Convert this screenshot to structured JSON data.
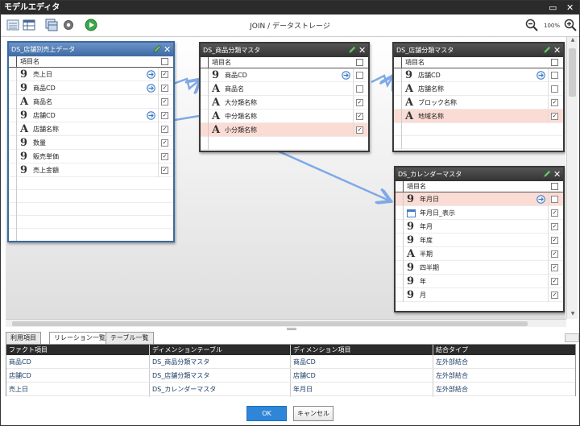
{
  "window": {
    "title": "モデルエディタ"
  },
  "toolbar": {
    "title": "JOIN / データストレージ",
    "zoom": "100%",
    "icons": [
      "list-view-icon",
      "table-view-icon",
      "add-table-icon",
      "settings-gear-icon",
      "run-icon",
      "zoom-out-icon",
      "zoom-in-icon"
    ]
  },
  "tables": [
    {
      "name": "DS_店舗別売上データ",
      "column_header": "項目名",
      "rows": [
        {
          "icon": "9",
          "name": "売上日",
          "join": true,
          "checked": true,
          "hl": false
        },
        {
          "icon": "9",
          "name": "商品CD",
          "join": true,
          "checked": true,
          "hl": false
        },
        {
          "icon": "A",
          "name": "商品名",
          "join": false,
          "checked": true,
          "hl": false
        },
        {
          "icon": "9",
          "name": "店舗CD",
          "join": true,
          "checked": true,
          "hl": false
        },
        {
          "icon": "A",
          "name": "店舗名称",
          "join": false,
          "checked": true,
          "hl": false
        },
        {
          "icon": "9",
          "name": "数量",
          "join": false,
          "checked": true,
          "hl": false
        },
        {
          "icon": "9",
          "name": "販売単価",
          "join": false,
          "checked": true,
          "hl": false
        },
        {
          "icon": "9",
          "name": "売上金額",
          "join": false,
          "checked": true,
          "hl": false
        }
      ]
    },
    {
      "name": "DS_商品分類マスタ",
      "column_header": "項目名",
      "rows": [
        {
          "icon": "9",
          "name": "商品CD",
          "join": true,
          "checked": false,
          "hl": false
        },
        {
          "icon": "A",
          "name": "商品名",
          "join": false,
          "checked": false,
          "hl": false
        },
        {
          "icon": "A",
          "name": "大分類名称",
          "join": false,
          "checked": true,
          "hl": false
        },
        {
          "icon": "A",
          "name": "中分類名称",
          "join": false,
          "checked": true,
          "hl": false
        },
        {
          "icon": "A",
          "name": "小分類名称",
          "join": false,
          "checked": true,
          "hl": true
        }
      ]
    },
    {
      "name": "DS_店舗分類マスタ",
      "column_header": "項目名",
      "rows": [
        {
          "icon": "9",
          "name": "店舗CD",
          "join": true,
          "checked": false,
          "hl": false
        },
        {
          "icon": "A",
          "name": "店舗名称",
          "join": false,
          "checked": false,
          "hl": false
        },
        {
          "icon": "A",
          "name": "ブロック名称",
          "join": false,
          "checked": true,
          "hl": false
        },
        {
          "icon": "A",
          "name": "地域名称",
          "join": false,
          "checked": true,
          "hl": true
        }
      ]
    },
    {
      "name": "DS_カレンダーマスタ",
      "column_header": "項目名",
      "rows": [
        {
          "icon": "9",
          "name": "年月日",
          "join": true,
          "checked": false,
          "hl": true
        },
        {
          "icon": "cal",
          "name": "年月日_表示",
          "join": false,
          "checked": true,
          "hl": false
        },
        {
          "icon": "9",
          "name": "年月",
          "join": false,
          "checked": true,
          "hl": false
        },
        {
          "icon": "9",
          "name": "年度",
          "join": false,
          "checked": true,
          "hl": false
        },
        {
          "icon": "A",
          "name": "半期",
          "join": false,
          "checked": true,
          "hl": false
        },
        {
          "icon": "9",
          "name": "四半期",
          "join": false,
          "checked": true,
          "hl": false
        },
        {
          "icon": "9",
          "name": "年",
          "join": false,
          "checked": true,
          "hl": false
        },
        {
          "icon": "9",
          "name": "月",
          "join": false,
          "checked": true,
          "hl": false
        }
      ]
    }
  ],
  "tabs": [
    "利用項目",
    "リレーション一覧",
    "テーブル一覧"
  ],
  "relation_grid": {
    "headers": [
      "ファクト項目",
      "ディメンションテーブル",
      "ディメンション項目",
      "結合タイプ"
    ],
    "rows": [
      [
        "商品CD",
        "DS_商品分類マスタ",
        "商品CD",
        "左外部結合"
      ],
      [
        "店舗CD",
        "DS_店舗分類マスタ",
        "店舗CD",
        "左外部結合"
      ],
      [
        "売上日",
        "DS_カレンダーマスタ",
        "年月日",
        "左外部結合"
      ]
    ]
  },
  "buttons": {
    "ok": "OK",
    "cancel": "キャンセル"
  },
  "colors": {
    "accent": "#2f86d8",
    "connector": "#7fa9e6",
    "highlight": "#fbdcd4",
    "header_dark": "#2b2b2b"
  }
}
